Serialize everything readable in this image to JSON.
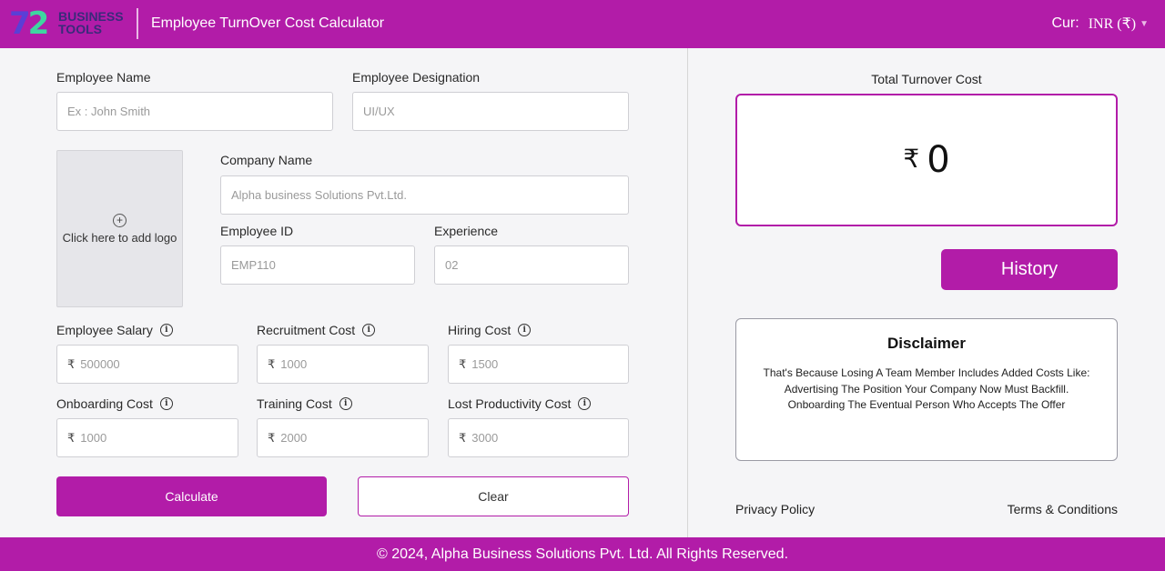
{
  "header": {
    "logo_number": "72",
    "logo_text_line1": "BUSINESS",
    "logo_text_line2": "TOOLS",
    "title": "Employee TurnOver Cost Calculator",
    "currency_label": "Cur:",
    "currency_value": "INR (₹)",
    "colors": {
      "brand": "#b21ca8"
    }
  },
  "form": {
    "employee_name": {
      "label": "Employee Name",
      "placeholder": "Ex : John Smith"
    },
    "employee_designation": {
      "label": "Employee Designation",
      "placeholder": "UI/UX"
    },
    "logo_upload": {
      "text": "Click here to add logo",
      "icon": "plus-circle-icon"
    },
    "company_name": {
      "label": "Company Name",
      "placeholder": "Alpha business Solutions Pvt.Ltd."
    },
    "employee_id": {
      "label": "Employee ID",
      "placeholder": "EMP110"
    },
    "experience": {
      "label": "Experience",
      "placeholder": "02"
    },
    "currency_symbol": "₹",
    "employee_salary": {
      "label": "Employee Salary",
      "placeholder": "500000"
    },
    "recruitment_cost": {
      "label": "Recruitment Cost",
      "placeholder": "1000"
    },
    "hiring_cost": {
      "label": "Hiring Cost",
      "placeholder": "1500"
    },
    "onboarding_cost": {
      "label": "Onboarding Cost",
      "placeholder": "1000"
    },
    "training_cost": {
      "label": "Training Cost",
      "placeholder": "2000"
    },
    "lost_productivity_cost": {
      "label": "Lost Productivity Cost",
      "placeholder": "3000"
    },
    "calculate_label": "Calculate",
    "clear_label": "Clear"
  },
  "result": {
    "total_label": "Total Turnover Cost",
    "currency_symbol": "₹",
    "total_value": "0",
    "history_label": "History"
  },
  "disclaimer": {
    "title": "Disclaimer",
    "line1": "That's Because Losing A Team Member Includes Added Costs Like:",
    "line2": "Advertising The Position Your Company Now Must Backfill.",
    "line3": "Onboarding The Eventual Person Who Accepts The Offer"
  },
  "links": {
    "privacy": "Privacy Policy",
    "terms": "Terms & Conditions"
  },
  "footer": {
    "copyright": "© 2024, Alpha Business Solutions Pvt. Ltd. All Rights Reserved."
  }
}
